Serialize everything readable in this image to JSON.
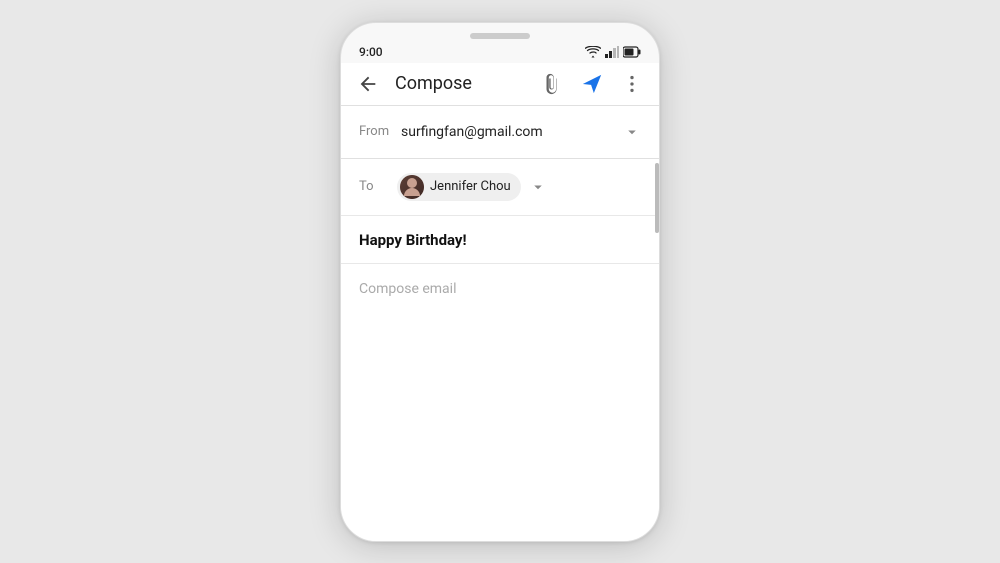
{
  "phone": {
    "notch": true,
    "status_bar": {
      "time": "9:00",
      "wifi_icon": "wifi-icon",
      "signal_icon": "signal-icon",
      "battery_icon": "battery-icon"
    },
    "app_bar": {
      "back_label": "←",
      "title": "Compose",
      "attach_icon": "attach-icon",
      "send_icon": "send-icon",
      "more_icon": "more-vert-icon"
    },
    "from_field": {
      "label": "From",
      "value": "surfingfan@gmail.com",
      "chevron": "chevron-down-icon"
    },
    "to_field": {
      "label": "To",
      "recipient_name": "Jennifer Chou",
      "chevron": "chevron-down-icon"
    },
    "subject_field": {
      "value": "Happy Birthday!"
    },
    "body_field": {
      "placeholder": "Compose email"
    }
  },
  "colors": {
    "send_blue": "#1a73e8",
    "background": "#f8f8f8",
    "text_primary": "#222222",
    "text_secondary": "#888888",
    "divider": "#e0e0e0"
  }
}
